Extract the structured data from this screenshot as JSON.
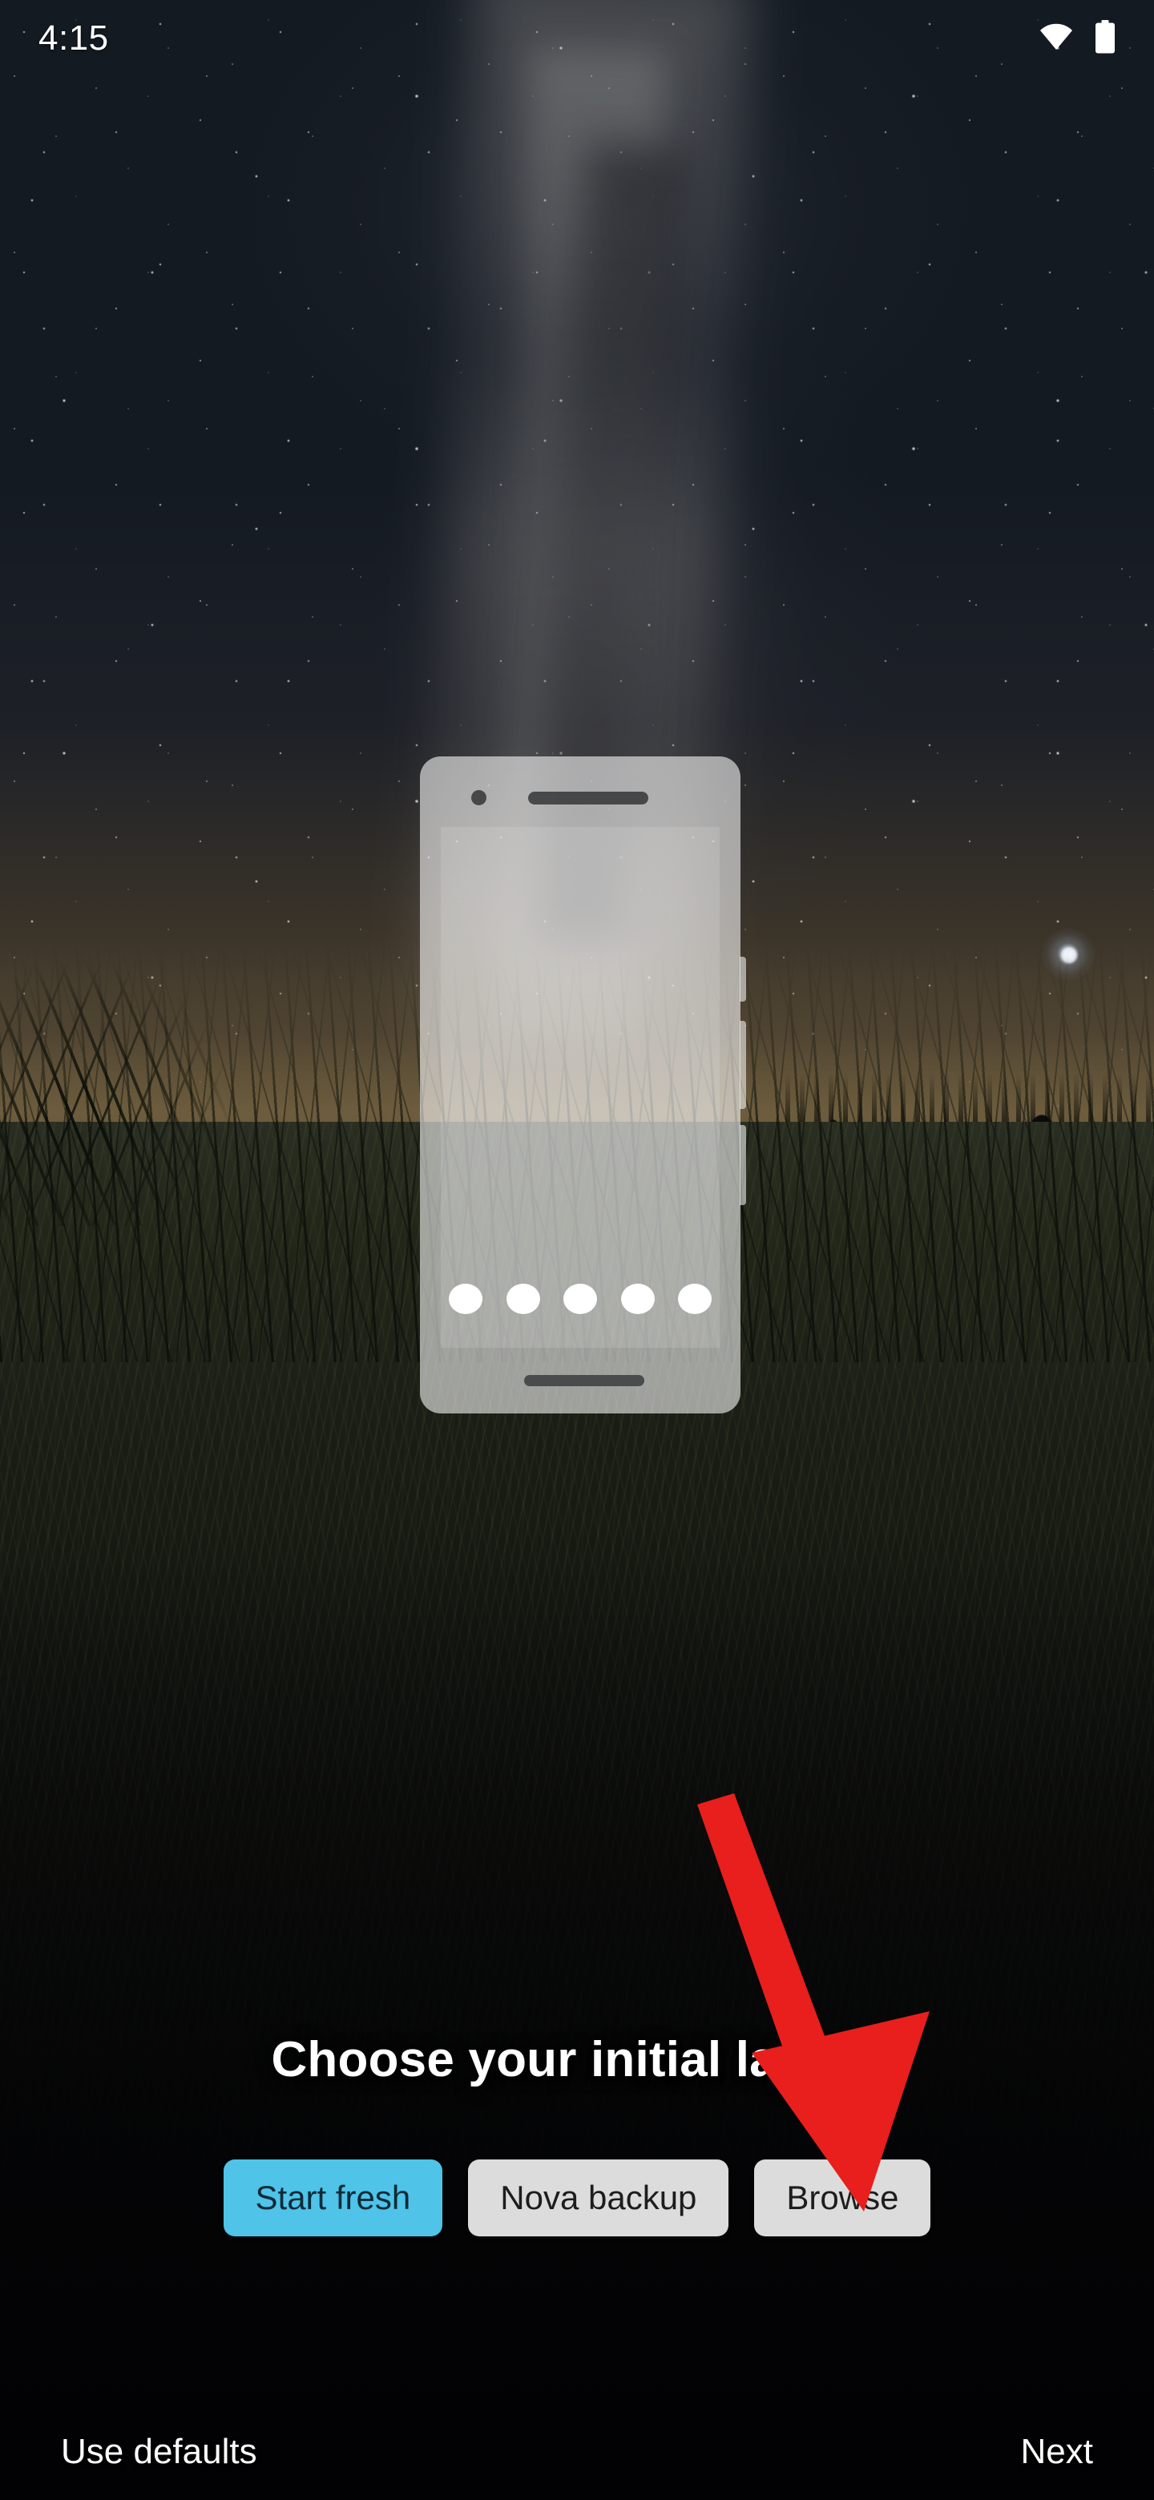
{
  "status_bar": {
    "time": "4:15",
    "icons": [
      {
        "name": "wifi-icon",
        "label": "Wi-Fi signal full"
      },
      {
        "name": "battery-icon",
        "label": "Battery full"
      }
    ]
  },
  "preview": {
    "name": "phone-layout-preview",
    "description": "Translucent phone mockup showing home screen layout preview",
    "dock_icon_count": 5,
    "elements": {
      "camera": "front-camera",
      "speaker": "earpiece-speaker",
      "home_indicator": "home-indicator-bar"
    }
  },
  "setup": {
    "title": "Choose your initial layout",
    "options": [
      {
        "id": "start-fresh",
        "label": "Start fresh",
        "style": "primary",
        "selected": true
      },
      {
        "id": "nova-backup",
        "label": "Nova backup",
        "style": "secondary",
        "selected": false
      },
      {
        "id": "browse",
        "label": "Browse",
        "style": "secondary",
        "selected": false
      }
    ]
  },
  "navigation": {
    "secondary_action": "Use defaults",
    "primary_action": "Next"
  },
  "annotation": {
    "type": "arrow",
    "color": "#E81F1C",
    "points_to": "browse",
    "direction": "down-right"
  },
  "colors": {
    "accent_primary": "#4FC3E8",
    "chip_secondary": "#DCDCDC",
    "chip_primary_text": "#0D2A38",
    "chip_secondary_text": "#1D1D1D",
    "text_on_wallpaper": "#FFFFFF",
    "annotation_red": "#E81F1C",
    "wallpaper_sky": "#141A22",
    "wallpaper_ground": "#0A0B08"
  },
  "wallpaper": {
    "name": "milky-way-night-field",
    "description": "Night sky with Milky Way over a grassy field"
  }
}
